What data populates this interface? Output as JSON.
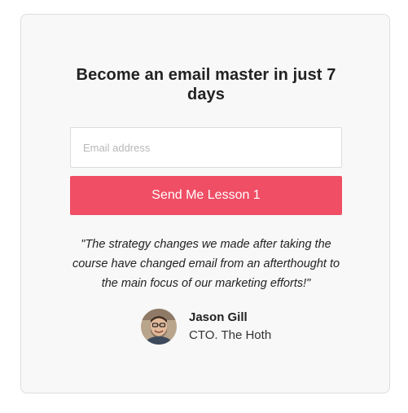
{
  "form": {
    "title": "Become an email master in just 7 days",
    "email_placeholder": "Email address",
    "email_value": "",
    "submit_label": "Send Me Lesson 1"
  },
  "testimonial": {
    "quote": "\"The strategy changes we made after taking the course have changed email from an afterthought to the main focus of our marketing efforts!\"",
    "author_name": "Jason Gill",
    "author_role": "CTO. The Hoth"
  },
  "colors": {
    "card_background": "#f8f8f8",
    "card_border": "#dedede",
    "button_background": "#ef4e65",
    "button_text": "#ffffff",
    "text_primary": "#222222"
  }
}
